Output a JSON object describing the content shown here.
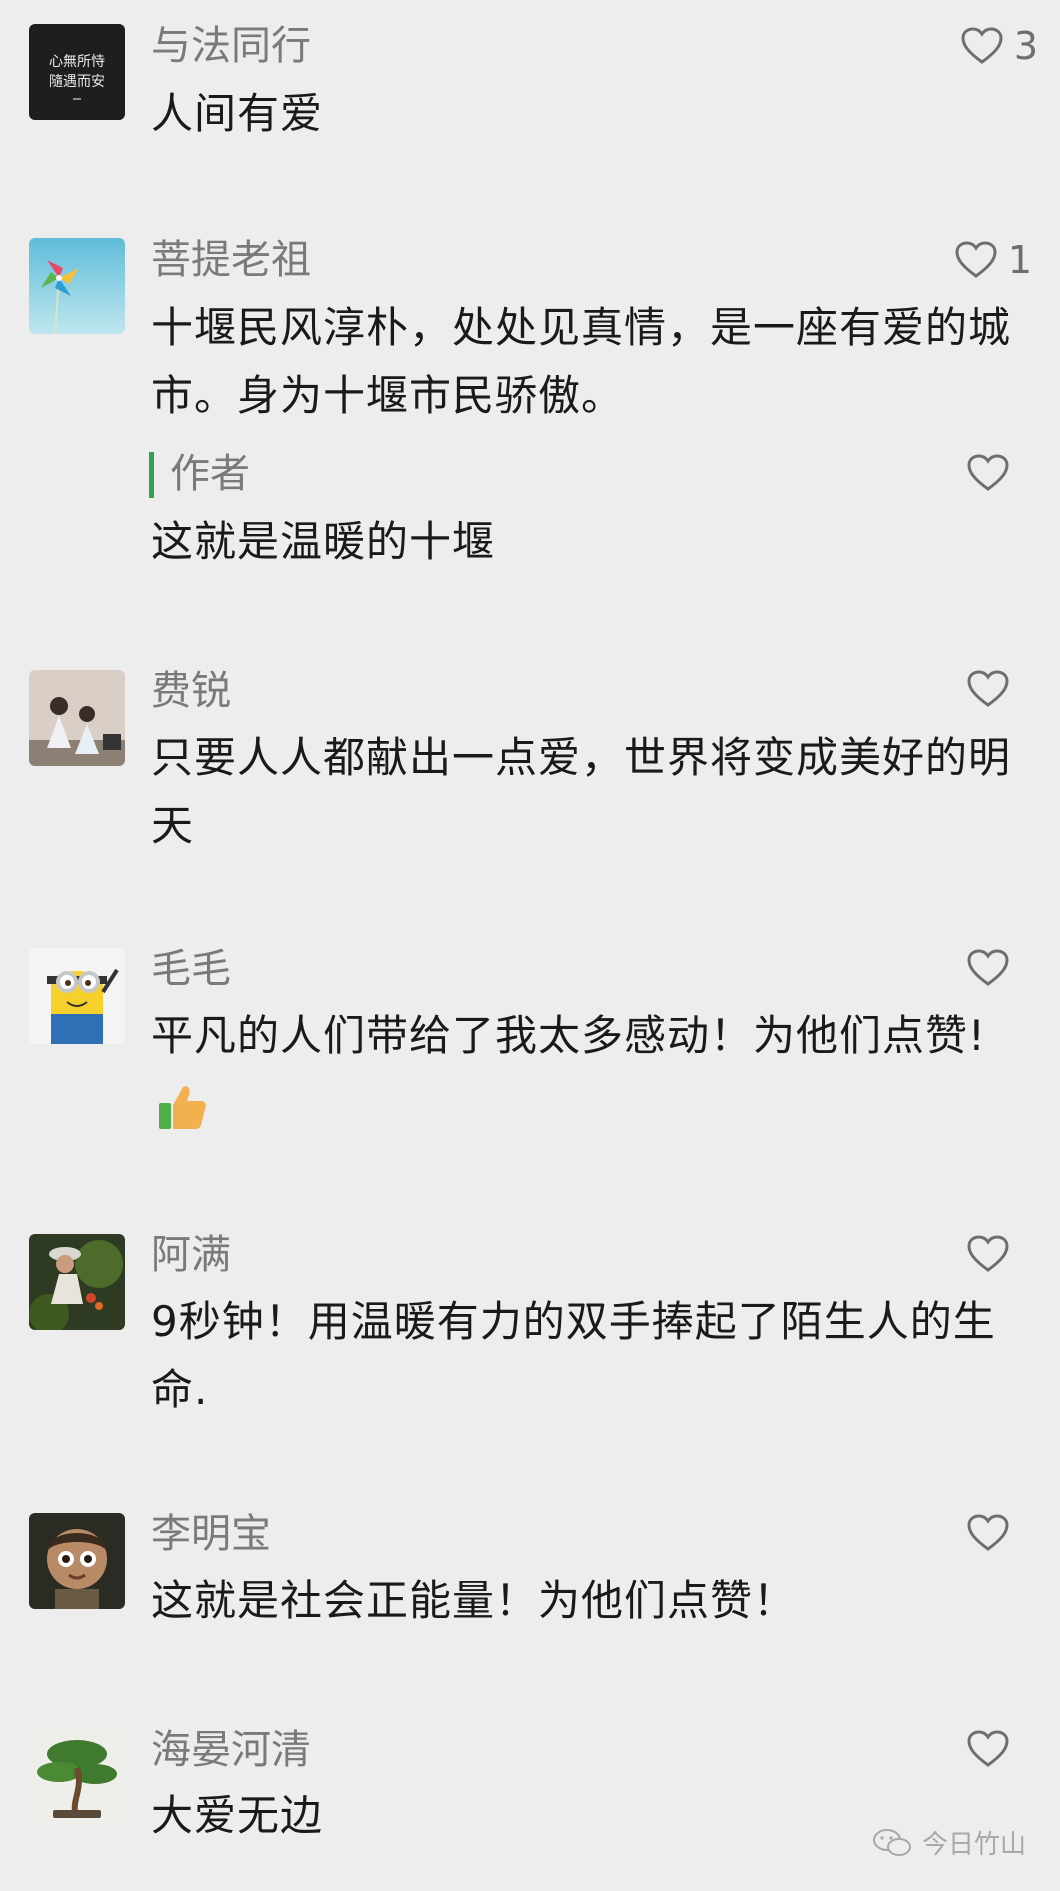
{
  "comments": [
    {
      "name": "与法同行",
      "text": "人间有爱",
      "likes": "3",
      "avatar_text_top": "心無所恃",
      "avatar_text_bottom": "隨遇而安"
    },
    {
      "name": "菩提老祖",
      "text": "十堰民风淳朴，处处见真情，是一座有爱的城市。身为十堰市民骄傲。",
      "likes": "1",
      "reply": {
        "author_label": "作者",
        "text": "这就是温暖的十堰"
      }
    },
    {
      "name": "费锐",
      "text": "只要人人都献出一点爱，世界将变成美好的明天"
    },
    {
      "name": "毛毛",
      "text": "平凡的人们带给了我太多感动！为他们点赞!",
      "emoji": "thumbs-up-icon"
    },
    {
      "name": "阿满",
      "text": "9秒钟！用温暖有力的双手捧起了陌生人的生命."
    },
    {
      "name": "李明宝",
      "text": "这就是社会正能量！为他们点赞！"
    },
    {
      "name": "海晏河清",
      "text": "大爱无边"
    }
  ],
  "watermark": {
    "text": "今日竹山",
    "icon": "wechat-icon"
  },
  "colors": {
    "background": "#ededed",
    "name": "#7a7a7a",
    "text": "#1a1a1a",
    "reply_accent": "#2ea44f",
    "like_icon": "#6e6e6e"
  }
}
